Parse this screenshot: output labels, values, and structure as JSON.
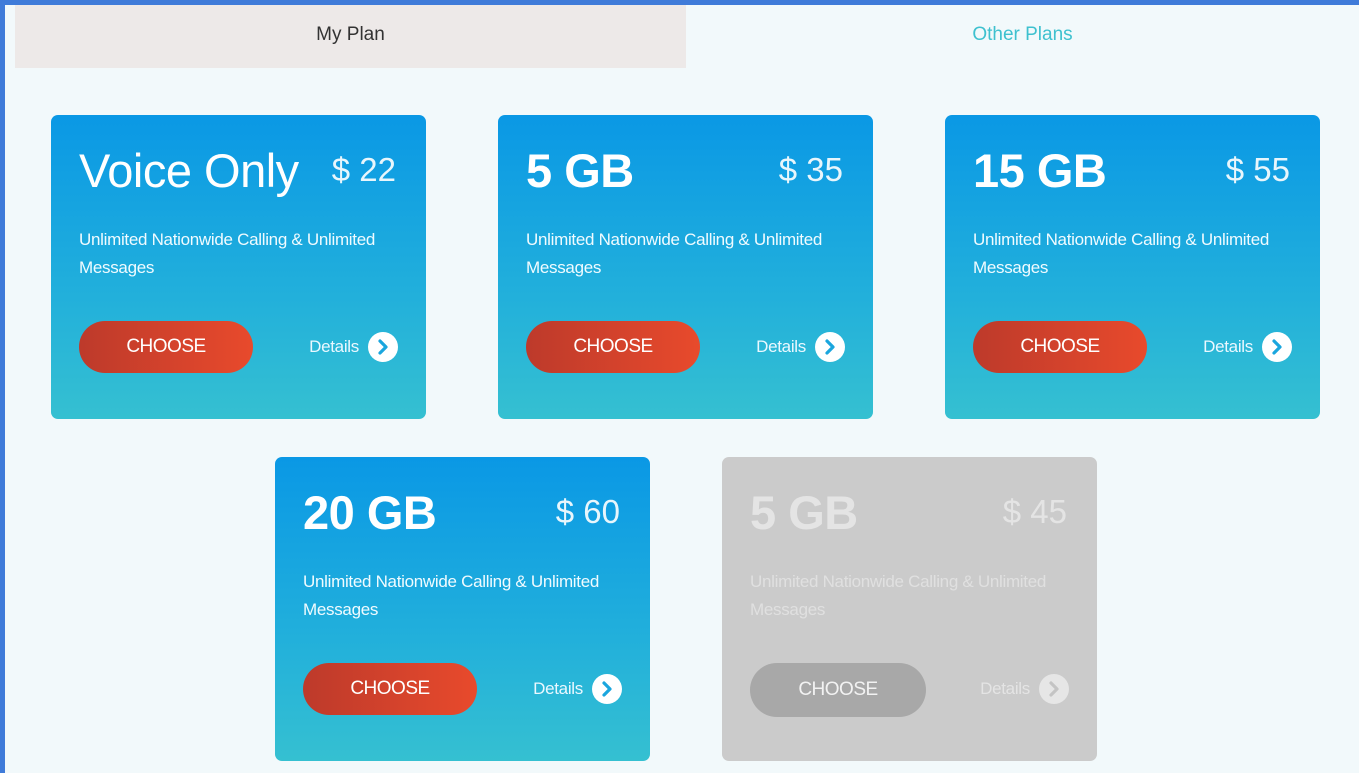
{
  "tabs": {
    "my_plan": "My Plan",
    "other_plans": "Other Plans"
  },
  "colors": {
    "accent_teal": "#3ec1cf",
    "card_gradient_top": "#0a98e5",
    "card_gradient_bottom": "#35c0d1",
    "choose_button": "#e84a2c",
    "disabled_card": "#cbcbcb"
  },
  "plans": [
    {
      "name": "Voice Only",
      "price": "$ 22",
      "description": "Unlimited Nationwide Calling & Unlimited Messages",
      "choose_label": "CHOOSE",
      "details_label": "Details",
      "icon": "chevron-right-icon",
      "enabled": true
    },
    {
      "name": "5 GB",
      "price": "$ 35",
      "description": "Unlimited Nationwide Calling & Unlimited Messages",
      "choose_label": "CHOOSE",
      "details_label": "Details",
      "icon": "chevron-right-icon",
      "enabled": true
    },
    {
      "name": "15 GB",
      "price": "$ 55",
      "description": "Unlimited Nationwide Calling & Unlimited Messages",
      "choose_label": "CHOOSE",
      "details_label": "Details",
      "icon": "chevron-right-icon",
      "enabled": true
    },
    {
      "name": "20 GB",
      "price": "$ 60",
      "description": "Unlimited Nationwide Calling & Unlimited Messages",
      "choose_label": "CHOOSE",
      "details_label": "Details",
      "icon": "chevron-right-icon",
      "enabled": true
    },
    {
      "name": "5 GB",
      "price": "$ 45",
      "description": "Unlimited Nationwide Calling & Unlimited Messages",
      "choose_label": "CHOOSE",
      "details_label": "Details",
      "icon": "chevron-right-icon",
      "enabled": false
    }
  ]
}
